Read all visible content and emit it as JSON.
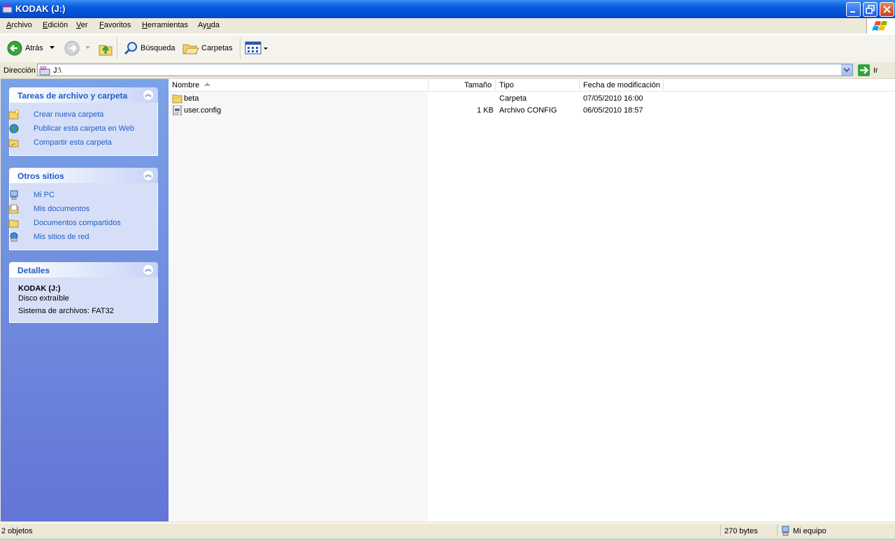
{
  "window": {
    "title": "KODAK (J:)"
  },
  "menu": {
    "items": [
      {
        "prefix": "",
        "accel": "A",
        "rest": "rchivo"
      },
      {
        "prefix": "",
        "accel": "E",
        "rest": "dición"
      },
      {
        "prefix": "",
        "accel": "V",
        "rest": "er"
      },
      {
        "prefix": "",
        "accel": "F",
        "rest": "avoritos"
      },
      {
        "prefix": "",
        "accel": "H",
        "rest": "erramientas"
      },
      {
        "prefix": "Ay",
        "accel": "u",
        "rest": "da"
      }
    ]
  },
  "toolbar": {
    "back_label": "Atrás",
    "search_label": "Búsqueda",
    "folders_label": "Carpetas"
  },
  "address": {
    "label": "Dirección",
    "value": "J:\\",
    "go_label": "Ir"
  },
  "taskpane": {
    "tasks": {
      "title": "Tareas de archivo y carpeta",
      "items": [
        "Crear nueva carpeta",
        "Publicar esta carpeta en Web",
        "Compartir esta carpeta"
      ]
    },
    "places": {
      "title": "Otros sitios",
      "items": [
        "Mi PC",
        "Mis documentos",
        "Documentos compartidos",
        "Mis sitios de red"
      ]
    },
    "details": {
      "title": "Detalles",
      "name": "KODAK (J:)",
      "type": "Disco extraíble",
      "fs": "Sistema de archivos: FAT32"
    }
  },
  "list": {
    "columns": [
      "Nombre",
      "Tamaño",
      "Tipo",
      "Fecha de modificación"
    ],
    "rows": [
      {
        "name": "beta",
        "size": "",
        "type": "Carpeta",
        "date": "07/05/2010 16:00",
        "icon": "folder-icon"
      },
      {
        "name": "user.config",
        "size": "1 KB",
        "type": "Archivo CONFIG",
        "date": "06/05/2010 18:57",
        "icon": "config-file-icon"
      }
    ]
  },
  "status": {
    "count": "2 objetos",
    "size": "270 bytes",
    "location": "Mi equipo"
  },
  "colors": {
    "title_bar": "#0550d8",
    "link": "#215dc6",
    "taskpane": "#6c8fde"
  }
}
